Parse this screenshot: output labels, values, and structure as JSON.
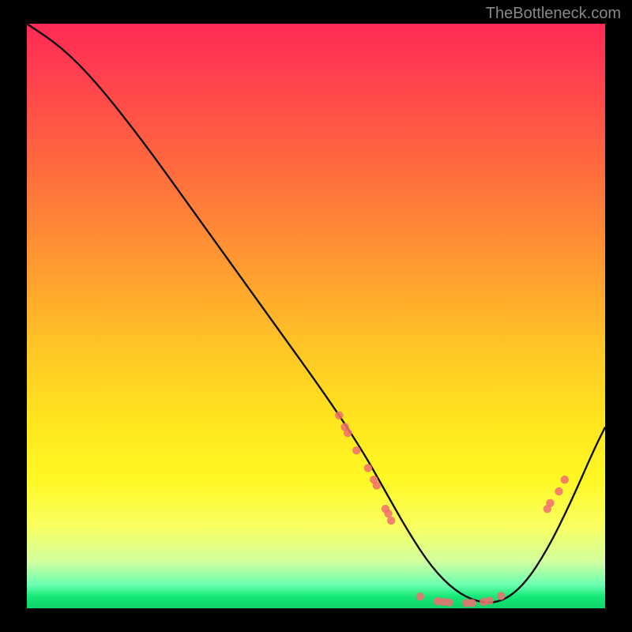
{
  "watermark": "TheBottleneck.com",
  "chart_data": {
    "type": "line",
    "title": "",
    "xlabel": "",
    "ylabel": "",
    "xlim": [
      0,
      100
    ],
    "ylim": [
      0,
      100
    ],
    "series": [
      {
        "name": "curve",
        "x": [
          0,
          6,
          12,
          20,
          28,
          36,
          44,
          52,
          58,
          62,
          66,
          70,
          74,
          78,
          82,
          86,
          90,
          94,
          98,
          100
        ],
        "y": [
          100,
          96,
          90,
          80,
          69,
          58,
          47,
          36,
          27,
          20,
          13,
          7,
          3,
          1,
          1,
          4,
          10,
          18,
          27,
          31
        ]
      }
    ],
    "markers": [
      {
        "x": 54,
        "y": 33
      },
      {
        "x": 55,
        "y": 31
      },
      {
        "x": 55.5,
        "y": 30
      },
      {
        "x": 57,
        "y": 27
      },
      {
        "x": 59,
        "y": 24
      },
      {
        "x": 60,
        "y": 22
      },
      {
        "x": 60.5,
        "y": 21
      },
      {
        "x": 62,
        "y": 17
      },
      {
        "x": 62.5,
        "y": 16.2
      },
      {
        "x": 63,
        "y": 15
      },
      {
        "x": 68,
        "y": 2
      },
      {
        "x": 71,
        "y": 1.2
      },
      {
        "x": 72,
        "y": 1.1
      },
      {
        "x": 73,
        "y": 1.0
      },
      {
        "x": 76,
        "y": 0.9
      },
      {
        "x": 77,
        "y": 0.9
      },
      {
        "x": 79,
        "y": 1.1
      },
      {
        "x": 80,
        "y": 1.3
      },
      {
        "x": 82,
        "y": 2.1
      },
      {
        "x": 90,
        "y": 17
      },
      {
        "x": 90.5,
        "y": 18
      },
      {
        "x": 92,
        "y": 20
      },
      {
        "x": 93,
        "y": 22
      }
    ],
    "background": {
      "type": "vertical-gradient",
      "stops": [
        {
          "pos": 0,
          "color": "#ff2a55"
        },
        {
          "pos": 30,
          "color": "#ff7a3a"
        },
        {
          "pos": 68,
          "color": "#ffe51e"
        },
        {
          "pos": 92,
          "color": "#d2ffa0"
        },
        {
          "pos": 100,
          "color": "#0fd368"
        }
      ]
    }
  }
}
